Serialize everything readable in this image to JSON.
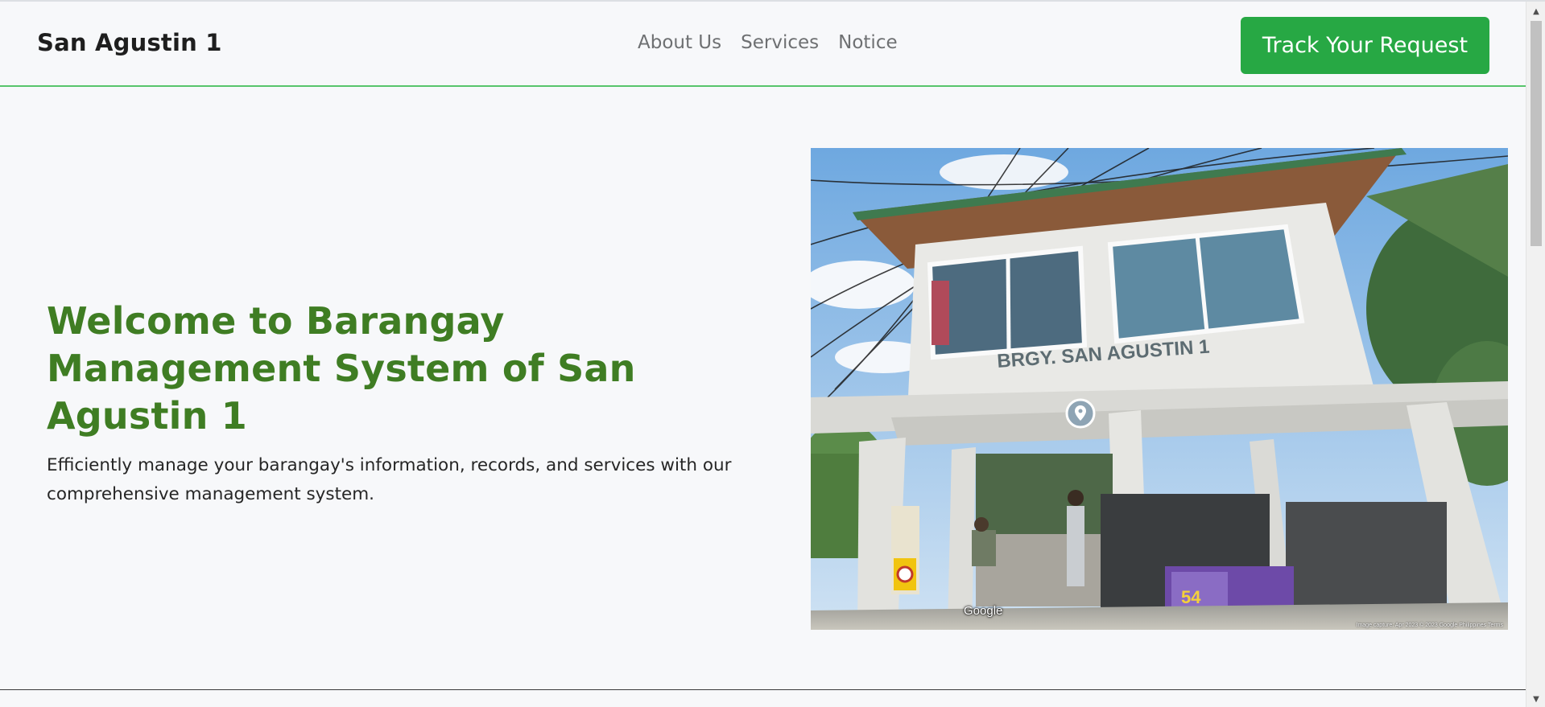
{
  "navbar": {
    "brand": "San Agustin 1",
    "links": [
      "About Us",
      "Services",
      "Notice"
    ],
    "cta_label": "Track Your Request"
  },
  "hero": {
    "title": "Welcome to Barangay Management System of San Agustin 1",
    "subtitle": "Efficiently manage your barangay's information, records, and services with our comprehensive management system."
  },
  "photo": {
    "sign_text": "BRGY. SAN AGUSTIN 1",
    "poster_number": "54",
    "provider": "Google",
    "caption": "Image capture: Apr 2023   © 2023 Google   Philippines   Terms"
  },
  "colors": {
    "accent_green": "#27a844",
    "title_green": "#3f7d23",
    "nav_border": "#57c46b"
  },
  "icons": [
    "map-pin-icon",
    "scroll-up-arrow-icon",
    "scroll-down-arrow-icon"
  ]
}
